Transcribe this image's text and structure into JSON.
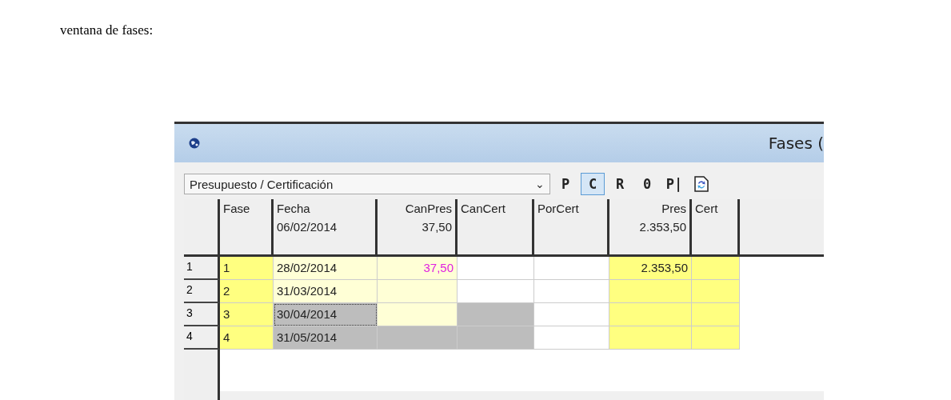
{
  "intro": "ventana de fases:",
  "window": {
    "title": "Fases (",
    "toolbar": {
      "dropdown": "Presupuesto / Certificación",
      "dropdown_arrow": "⌄",
      "buttons": [
        {
          "kind": "text",
          "label": "P",
          "selected": false
        },
        {
          "kind": "text",
          "label": "C",
          "selected": true
        },
        {
          "kind": "text",
          "label": "R",
          "selected": false
        },
        {
          "kind": "text",
          "label": "0",
          "selected": false
        },
        {
          "kind": "text",
          "label": "P|",
          "selected": false
        },
        {
          "kind": "icon",
          "selected": false
        }
      ]
    },
    "table": {
      "columns": [
        {
          "label": "Fase"
        },
        {
          "label": "Fecha",
          "total": "06/02/2014"
        },
        {
          "label": "CanPres",
          "total": "37,50"
        },
        {
          "label": "CanCert"
        },
        {
          "label": "PorCert"
        },
        {
          "label": "Pres",
          "total": "2.353,50"
        },
        {
          "label": "Cert"
        }
      ],
      "rows": [
        {
          "number": "1",
          "cells": [
            {
              "text": "1",
              "kind": "key"
            },
            {
              "text": "28/02/2014",
              "kind": "editable",
              "focused": false
            },
            {
              "text": "37,50",
              "kind": "editable",
              "modified": true
            },
            {
              "kind": "plain"
            },
            {
              "kind": "plain"
            },
            {
              "text": "2.353,50",
              "kind": "key"
            },
            {
              "kind": "key"
            }
          ]
        },
        {
          "number": "2",
          "cells": [
            {
              "text": "2",
              "kind": "key"
            },
            {
              "text": "31/03/2014",
              "kind": "editable",
              "focused": false
            },
            {
              "kind": "editable"
            },
            {
              "kind": "plain"
            },
            {
              "kind": "plain"
            },
            {
              "kind": "key"
            },
            {
              "kind": "key"
            }
          ]
        },
        {
          "number": "3",
          "cells": [
            {
              "text": "3",
              "kind": "key"
            },
            {
              "text": "30/04/2014",
              "kind": "locked",
              "focused": true
            },
            {
              "kind": "editable"
            },
            {
              "kind": "locked"
            },
            {
              "kind": "plain"
            },
            {
              "kind": "key"
            },
            {
              "kind": "key"
            }
          ]
        },
        {
          "number": "4",
          "cells": [
            {
              "text": "4",
              "kind": "key"
            },
            {
              "text": "31/05/2014",
              "kind": "locked",
              "focused": false
            },
            {
              "kind": "locked"
            },
            {
              "kind": "locked"
            },
            {
              "kind": "plain"
            },
            {
              "kind": "key"
            },
            {
              "kind": "key"
            }
          ]
        }
      ]
    }
  }
}
